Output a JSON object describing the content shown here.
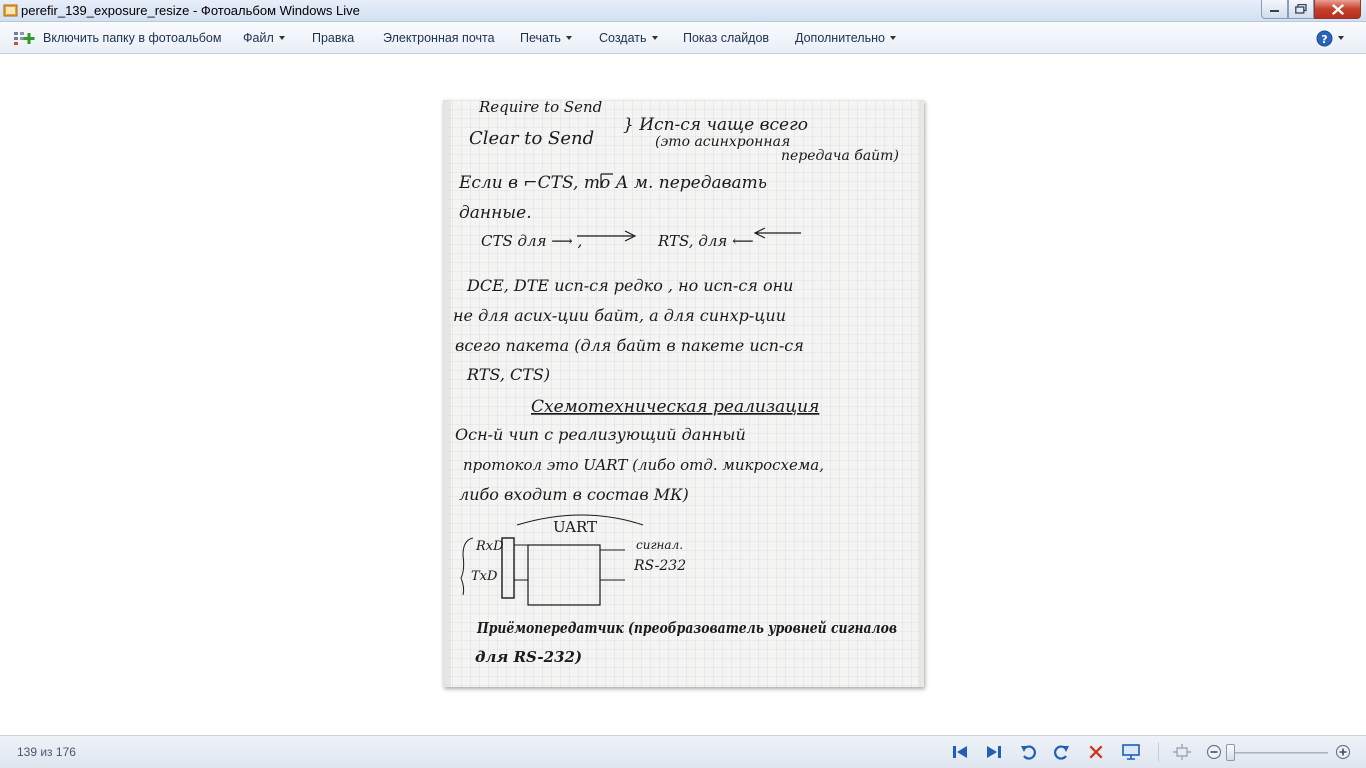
{
  "window": {
    "title": "perefir_139_exposure_resize - Фотоальбом Windows Live"
  },
  "menu": {
    "include_folder": "Включить папку в фотоальбом",
    "file": "Файл",
    "edit": "Правка",
    "email": "Электронная почта",
    "print": "Печать",
    "create": "Создать",
    "slideshow": "Показ слайдов",
    "more": "Дополнительно"
  },
  "photo": {
    "lines": [
      "Require to Send",
      "Clear to Send",
      "} Исп-ся чаще всего",
      "(это асинхронная",
      "передача байт)",
      "Если в ⌐CTS, то А м. передавать",
      "данные.",
      "CTS для ⟶ ,",
      "RTS, для ⟵",
      "DCE, DTE исп-ся редко , но исп-ся они",
      "не для асих-ции байт, а для синхр-ции",
      "всего пакета (для байт в пакете исп-ся",
      "RTS, CTS)",
      "Схемотехническая реализация",
      "Осн-й чип с реализующий данный",
      "протокол это UART (либо отд. микросхема,",
      "либо входит в состав МК)",
      "UART",
      "RxD",
      "TxD",
      "сигнал.",
      "RS-232",
      "Приёмопередатчик (преобразователь уровней сигналов",
      "для RS-232)"
    ]
  },
  "status": {
    "counter": "139 из 176"
  },
  "controls": {
    "zoom_level": 0.02
  },
  "colors": {
    "accent": "#1f5fb4",
    "delete": "#d03a28",
    "close_button": "#c7402c",
    "ink": "#1a1a1a",
    "paper": "#f4f4f2",
    "grid": "#c9cfd6"
  }
}
